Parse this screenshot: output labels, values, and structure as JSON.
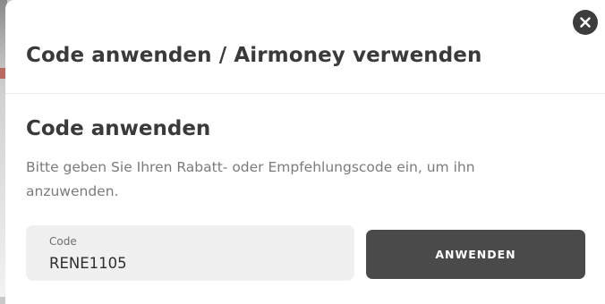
{
  "modal": {
    "title": "Code anwenden / Airmoney verwenden",
    "close_icon": "close-icon"
  },
  "code_section": {
    "title": "Code anwenden",
    "description": "Bitte geben Sie Ihren Rabatt- oder Empfehlungscode ein, um ihn anzuwenden.",
    "field_label": "Code",
    "field_value": "RENE1105",
    "apply_label": "ANWENDEN"
  },
  "colors": {
    "button_bg": "#4a4a4a",
    "close_bg": "#3d3d3d",
    "field_bg": "#f0f0f0",
    "title_text": "#3a3a3a",
    "muted_text": "#7b7b7b"
  }
}
